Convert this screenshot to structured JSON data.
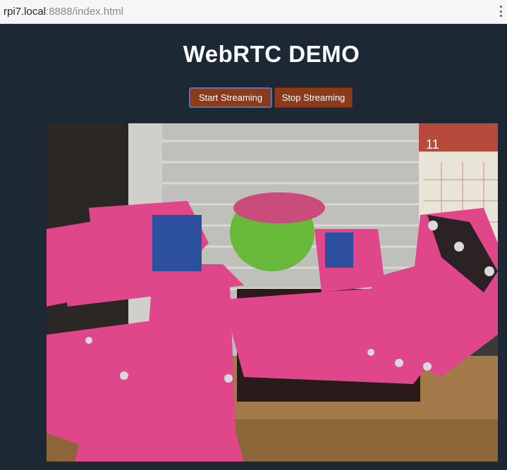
{
  "browser": {
    "url_host": "rpi7.local",
    "url_rest": ":8888/index.html"
  },
  "page": {
    "title": "WebRTC DEMO",
    "start_label": "Start Streaming",
    "stop_label": "Stop Streaming"
  },
  "video": {
    "calendar_label": "11"
  },
  "colors": {
    "background": "#1c2833",
    "button": "#8b3a1c",
    "focus_ring": "#4c7ab8"
  }
}
